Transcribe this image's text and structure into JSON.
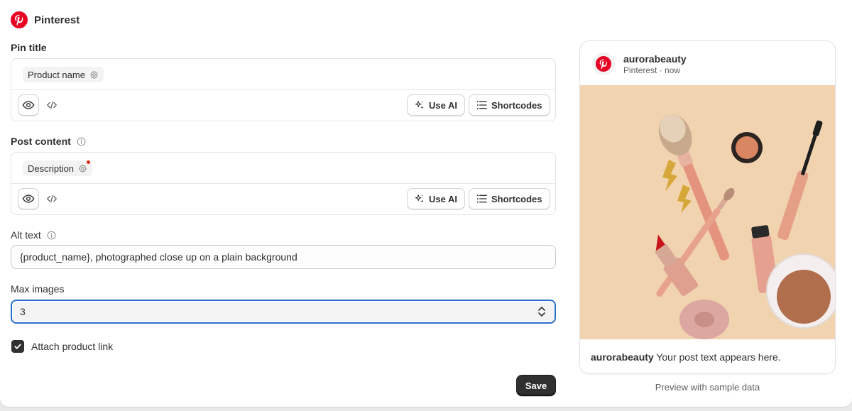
{
  "header": {
    "title": "Pinterest",
    "logo_icon": "pinterest-logo",
    "brand_color": "#e60023"
  },
  "pin_title": {
    "label": "Pin title",
    "token": "Product name",
    "use_ai_label": "Use AI",
    "shortcodes_label": "Shortcodes"
  },
  "post_content": {
    "label": "Post content",
    "token": "Description",
    "use_ai_label": "Use AI",
    "shortcodes_label": "Shortcodes"
  },
  "alt_text": {
    "label": "Alt text",
    "value": "{product_name}, photographed close up on a plain background"
  },
  "max_images": {
    "label": "Max images",
    "value": "3"
  },
  "attach_link": {
    "label": "Attach product link",
    "checked": true
  },
  "save_label": "Save",
  "preview": {
    "account": "aurorabeauty",
    "subtitle": "Pinterest · now",
    "caption_user": "aurorabeauty",
    "caption_text": " Your post text appears here.",
    "note": "Preview with sample data",
    "image_subject": "makeup-brushes-and-cosmetics"
  }
}
